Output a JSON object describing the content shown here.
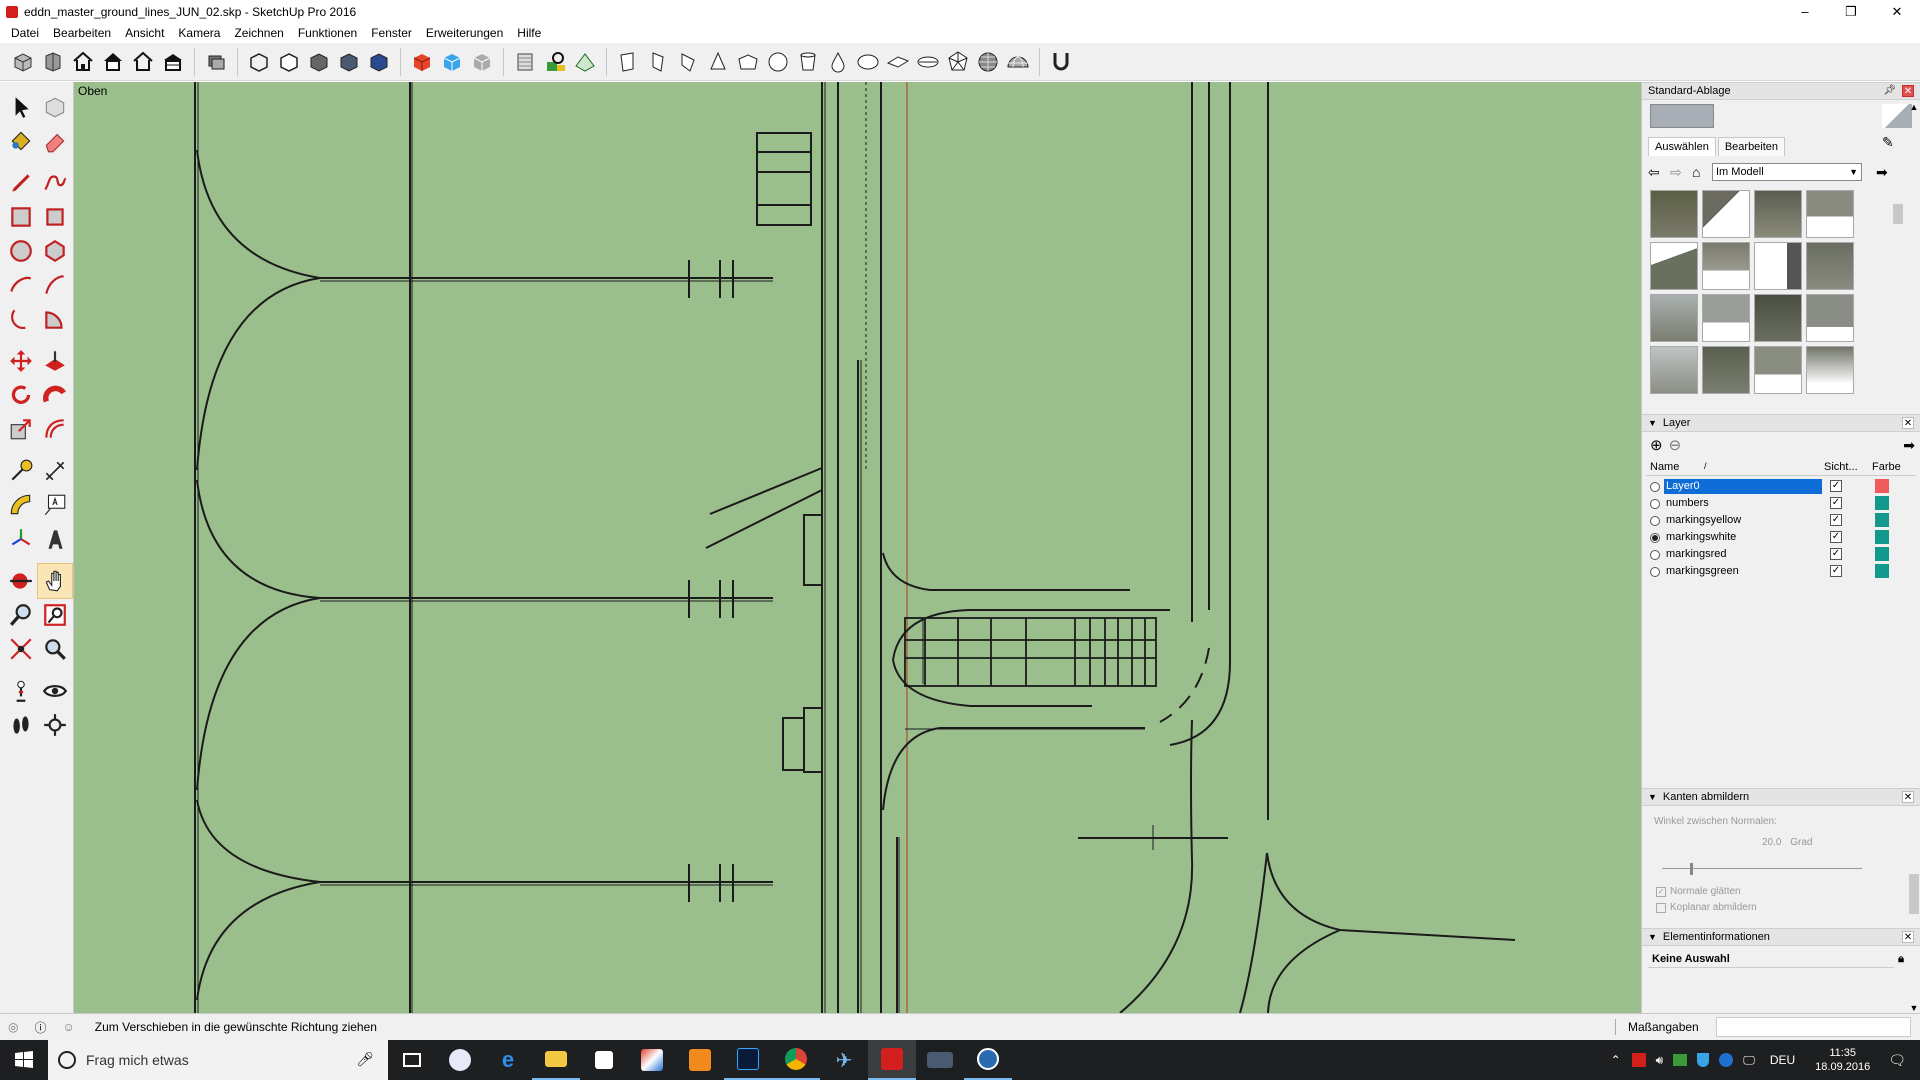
{
  "window": {
    "title": "eddn_master_ground_lines_JUN_02.skp - SketchUp Pro 2016",
    "minimize": "–",
    "restore": "❐",
    "close": "✕"
  },
  "menu": [
    "Datei",
    "Bearbeiten",
    "Ansicht",
    "Kamera",
    "Zeichnen",
    "Funktionen",
    "Fenster",
    "Erweiterungen",
    "Hilfe"
  ],
  "viewport": {
    "view_label": "Oben",
    "background": "#9bbf8c"
  },
  "standard_ablage": {
    "title": "Standard-Ablage",
    "tabs": [
      "Auswählen",
      "Bearbeiten"
    ],
    "location": "Im Modell"
  },
  "layer_panel": {
    "title": "Layer",
    "col_name": "Name",
    "col_visible": "Sicht...",
    "col_color": "Farbe",
    "layers": [
      {
        "name": "Layer0",
        "visible": true,
        "color": "#ef5b5b",
        "selected": true,
        "active": false
      },
      {
        "name": "numbers",
        "visible": true,
        "color": "#12998b",
        "selected": false,
        "active": false
      },
      {
        "name": "markingsyellow",
        "visible": true,
        "color": "#12998b",
        "selected": false,
        "active": false
      },
      {
        "name": "markingswhite",
        "visible": true,
        "color": "#12998b",
        "selected": false,
        "active": true
      },
      {
        "name": "markingsred",
        "visible": true,
        "color": "#12998b",
        "selected": false,
        "active": false
      },
      {
        "name": "markingsgreen",
        "visible": true,
        "color": "#12998b",
        "selected": false,
        "active": false
      }
    ]
  },
  "kanten": {
    "title": "Kanten abmildern",
    "angle_label": "Winkel zwischen Normalen:",
    "angle_value": "20.0",
    "angle_unit": "Grad",
    "slider_level": 0.14,
    "smooth_normals": "Normale glätten",
    "soften_coplanar": "Koplanar abmildern"
  },
  "entity_info": {
    "title": "Elementinformationen",
    "selection": "Keine Auswahl"
  },
  "status": {
    "message": "Zum Verschieben in die gewünschte Richtung ziehen",
    "measure_label": "Maßangaben"
  },
  "taskbar": {
    "search": "Frag mich etwas",
    "lang": "DEU",
    "time": "11:35",
    "date": "18.09.2016"
  }
}
